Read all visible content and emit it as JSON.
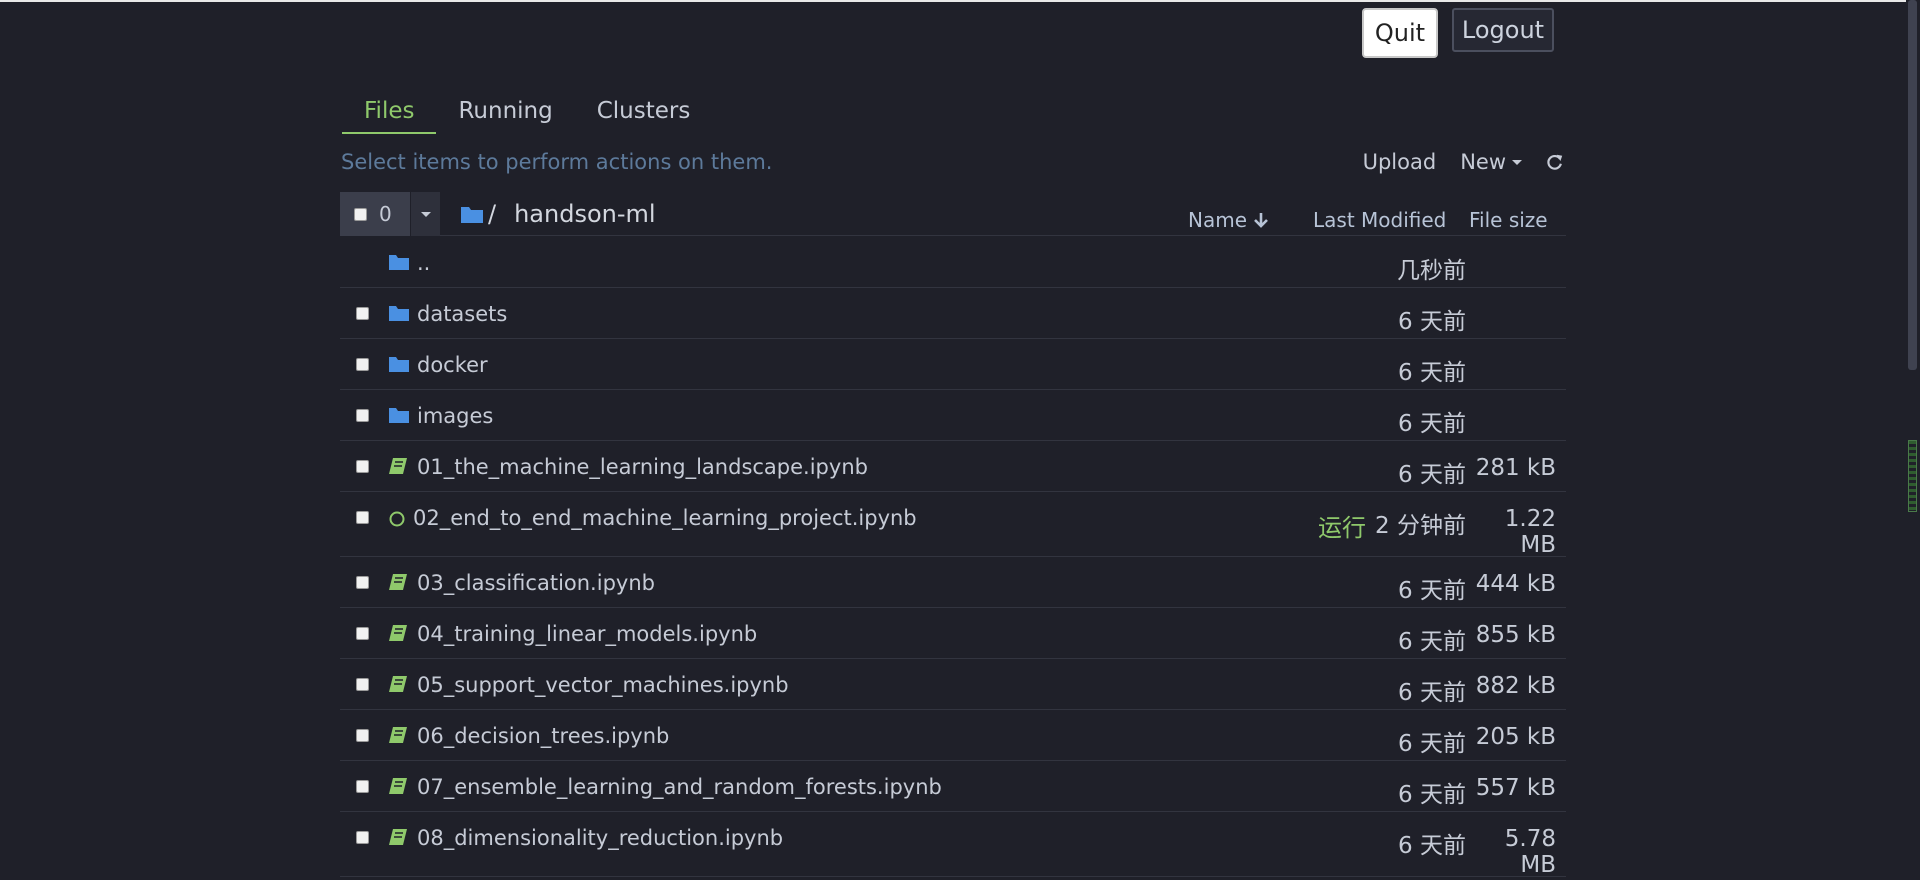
{
  "header": {
    "quit_label": "Quit",
    "logout_label": "Logout"
  },
  "tabs": [
    {
      "label": "Files",
      "active": true
    },
    {
      "label": "Running",
      "active": false
    },
    {
      "label": "Clusters",
      "active": false
    }
  ],
  "toolbar": {
    "hint": "Select items to perform actions on them.",
    "upload_label": "Upload",
    "new_label": "New"
  },
  "list_header": {
    "selected_count": "0",
    "breadcrumb_sep": "/",
    "breadcrumb_folder": "handson-ml",
    "col_name": "Name",
    "col_modified": "Last Modified",
    "col_size": "File size"
  },
  "files": [
    {
      "type": "parent",
      "name": "..",
      "modified": "几秒前",
      "size": ""
    },
    {
      "type": "folder",
      "name": "datasets",
      "modified": "6 天前",
      "size": ""
    },
    {
      "type": "folder",
      "name": "docker",
      "modified": "6 天前",
      "size": ""
    },
    {
      "type": "folder",
      "name": "images",
      "modified": "6 天前",
      "size": ""
    },
    {
      "type": "notebook",
      "name": "01_the_machine_learning_landscape.ipynb",
      "modified": "6 天前",
      "size": "281 kB"
    },
    {
      "type": "running",
      "name": "02_end_to_end_machine_learning_project.ipynb",
      "status": "运行",
      "modified": "2 分钟前",
      "size": "1.22 MB"
    },
    {
      "type": "notebook",
      "name": "03_classification.ipynb",
      "modified": "6 天前",
      "size": "444 kB"
    },
    {
      "type": "notebook",
      "name": "04_training_linear_models.ipynb",
      "modified": "6 天前",
      "size": "855 kB"
    },
    {
      "type": "notebook",
      "name": "05_support_vector_machines.ipynb",
      "modified": "6 天前",
      "size": "882 kB"
    },
    {
      "type": "notebook",
      "name": "06_decision_trees.ipynb",
      "modified": "6 天前",
      "size": "205 kB"
    },
    {
      "type": "notebook",
      "name": "07_ensemble_learning_and_random_forests.ipynb",
      "modified": "6 天前",
      "size": "557 kB"
    },
    {
      "type": "notebook",
      "name": "08_dimensionality_reduction.ipynb",
      "modified": "6 天前",
      "size": "5.78 MB"
    }
  ],
  "colors": {
    "background": "#1f2029",
    "accent_green": "#8fc96b",
    "folder_blue": "#4a90e2",
    "hint_blue": "#5d7a9b"
  },
  "icons": {
    "folder": "folder-icon",
    "notebook": "notebook-icon",
    "running": "running-circle-icon",
    "sort": "arrow-down-icon",
    "refresh": "refresh-icon"
  }
}
